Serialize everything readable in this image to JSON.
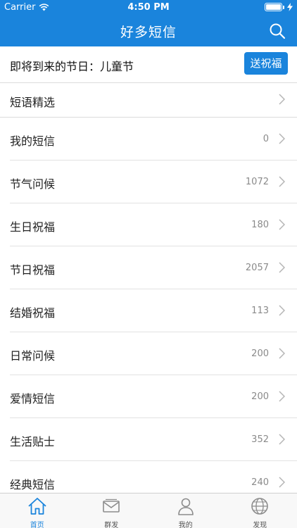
{
  "status_bar": {
    "carrier": "Carrier",
    "time": "4:50 PM"
  },
  "nav": {
    "title": "好多短信"
  },
  "festival": {
    "text": "即将到来的节日：儿童节",
    "button_label": "送祝福"
  },
  "quotes": {
    "label": "短语精选"
  },
  "categories": [
    {
      "label": "我的短信",
      "count": "0"
    },
    {
      "label": "节气问候",
      "count": "1072"
    },
    {
      "label": "生日祝福",
      "count": "180"
    },
    {
      "label": "节日祝福",
      "count": "2057"
    },
    {
      "label": "结婚祝福",
      "count": "113"
    },
    {
      "label": "日常问候",
      "count": "200"
    },
    {
      "label": "爱情短信",
      "count": "200"
    },
    {
      "label": "生活贴士",
      "count": "352"
    },
    {
      "label": "经典短信",
      "count": "240"
    }
  ],
  "tabs": [
    {
      "label": "首页",
      "icon": "home-icon",
      "active": true
    },
    {
      "label": "群发",
      "icon": "envelope-icon",
      "active": false
    },
    {
      "label": "我的",
      "icon": "person-icon",
      "active": false
    },
    {
      "label": "发现",
      "icon": "globe-icon",
      "active": false
    }
  ],
  "colors": {
    "accent": "#1a84dc",
    "background": "#f4f4f4",
    "count_text": "#8a8a8a"
  }
}
